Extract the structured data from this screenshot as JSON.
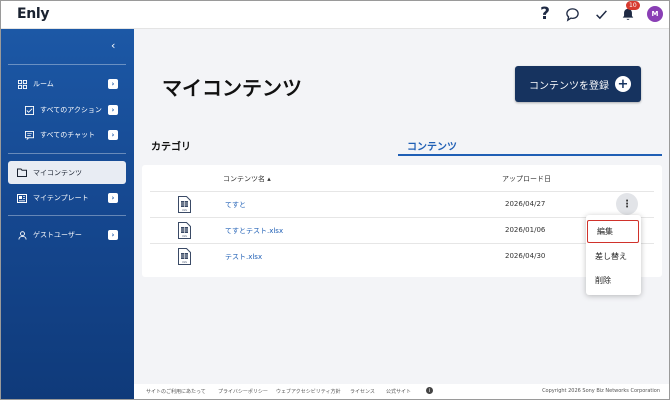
{
  "app": {
    "logo": "Enly"
  },
  "header": {
    "help_icon": "?",
    "notification_count": "10",
    "avatar_initial": "M"
  },
  "sidebar": {
    "collapse_icon": "‹",
    "items": [
      {
        "label": "ルーム",
        "icon": "grid-icon"
      },
      {
        "label": "すべてのアクション",
        "icon": "checkbox-icon"
      },
      {
        "label": "すべてのチャット",
        "icon": "chat-icon"
      },
      {
        "label": "マイコンテンツ",
        "icon": "folder-icon"
      },
      {
        "label": "マイテンプレート",
        "icon": "template-icon"
      },
      {
        "label": "ゲストユーザー",
        "icon": "user-icon"
      }
    ]
  },
  "main": {
    "title": "マイコンテンツ",
    "register_label": "コンテンツを登録",
    "tabs": {
      "category": "カテゴリ",
      "content": "コンテンツ"
    },
    "table": {
      "col_name": "コンテンツ名 ▴",
      "col_date": "アップロード日",
      "rows": [
        {
          "name": "てすと",
          "date": "2026/04/27"
        },
        {
          "name": "てすとテスト.xlsx",
          "date": "2026/01/06"
        },
        {
          "name": "テスト.xlsx",
          "date": "2026/04/30"
        }
      ]
    },
    "menu": {
      "edit": "編集",
      "replace": "差し替え",
      "delete": "削除"
    }
  },
  "footer": {
    "links": [
      "サイトのご利用にあたって",
      "プライバシーポリシー",
      "ウェブアクセシビリティ方針",
      "ライセンス",
      "公式サイト"
    ],
    "copyright": "Copyright 2026 Sony Biz Networks Corporation"
  },
  "colors": {
    "sidebar": "#1c58a6",
    "button": "#16335f",
    "accent": "#1f5fb5",
    "highlight": "#d0322b"
  }
}
